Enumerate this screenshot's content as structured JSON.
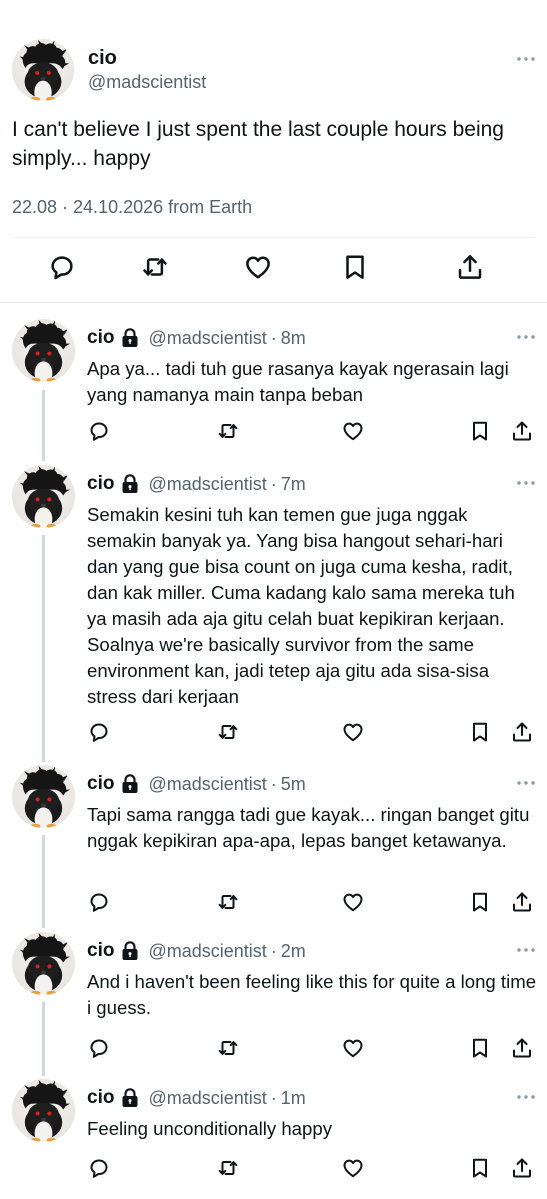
{
  "main_tweet": {
    "name": "cio",
    "handle": "@madscientist",
    "text": "I can't believe I just spent the last couple hours being simply... happy",
    "meta": "22.08 · 24.10.2026 from Earth"
  },
  "replies": [
    {
      "name": "cio",
      "handle": "@madscientist",
      "dot": "·",
      "time": "8m",
      "text": "Apa ya... tadi tuh gue rasanya kayak ngerasain lagi yang namanya main tanpa beban"
    },
    {
      "name": "cio",
      "handle": "@madscientist",
      "dot": "·",
      "time": "7m",
      "text": "Semakin kesini tuh kan temen gue juga nggak semakin banyak ya. Yang bisa hangout sehari-hari dan yang gue bisa count on juga cuma kesha, radit, dan kak miller. Cuma kadang kalo sama mereka tuh ya masih ada aja gitu celah buat kepikiran kerjaan. Soalnya we're basically survivor from the same environment kan, jadi tetep aja gitu ada sisa-sisa stress dari kerjaan"
    },
    {
      "name": "cio",
      "handle": "@madscientist",
      "dot": "·",
      "time": "5m",
      "text": "Tapi sama rangga tadi gue kayak... ringan banget gitu nggak kepikiran apa-apa, lepas banget ketawanya."
    },
    {
      "name": "cio",
      "handle": "@madscientist",
      "dot": "·",
      "time": "2m",
      "text": "And i haven't been feeling like this for quite a long time i guess."
    },
    {
      "name": "cio",
      "handle": "@madscientist",
      "dot": "·",
      "time": "1m",
      "text": "Feeling unconditionally happy"
    }
  ],
  "icons": {
    "avatar": "penguin-avatar",
    "more": "more-horizontal-icon",
    "lock": "lock-icon",
    "actions": [
      "reply-icon",
      "retweet-icon",
      "like-icon",
      "bookmark-icon",
      "share-icon"
    ]
  },
  "colors": {
    "text": "#0f1419",
    "secondary": "#536471",
    "divider": "#eff3f4",
    "thread_line": "#cfd9de"
  }
}
